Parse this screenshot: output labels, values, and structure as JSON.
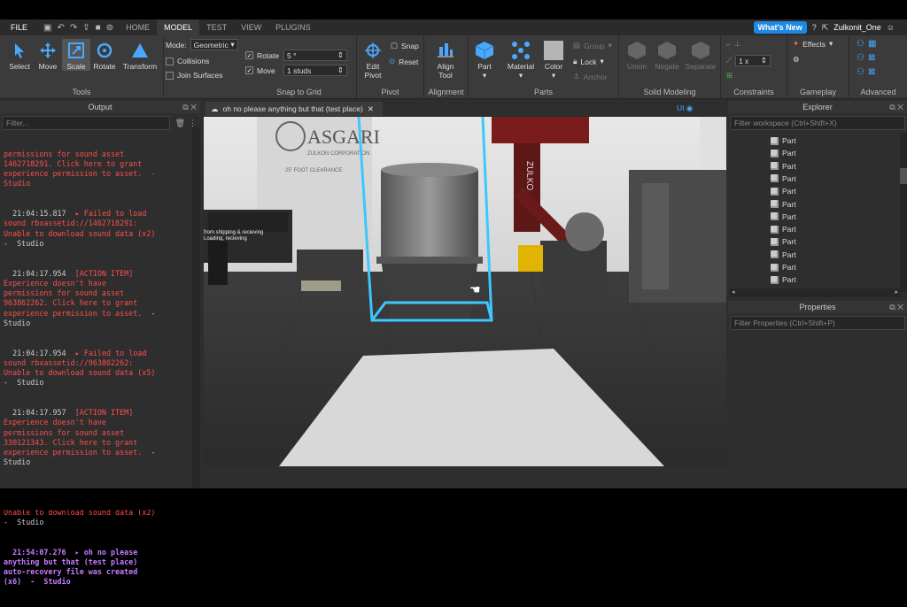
{
  "menubar": {
    "file": "FILE",
    "tabs": [
      "HOME",
      "MODEL",
      "TEST",
      "VIEW",
      "PLUGINS"
    ],
    "active_tab": "MODEL",
    "whats_new": "What's New",
    "username": "Zulkonit_One"
  },
  "ribbon": {
    "tools": {
      "select": "Select",
      "move": "Move",
      "scale": "Scale",
      "rotate": "Rotate",
      "transform": "Transform",
      "group": "Tools"
    },
    "mode_label": "Mode:",
    "mode_value": "Geometric",
    "collisions": "Collisions",
    "join_surfaces": "Join Surfaces",
    "snap": {
      "rotate_label": "Rotate",
      "rotate_value": "5 °",
      "move_label": "Move",
      "move_value": "1 studs",
      "group": "Snap to Grid"
    },
    "pivot": {
      "edit_pivot": "Edit\nPivot",
      "snap": "Snap",
      "reset": "Reset",
      "group": "Pivot"
    },
    "alignment": {
      "align_tool": "Align\nTool",
      "group": "Alignment"
    },
    "parts": {
      "part": "Part",
      "material": "Material",
      "color": "Color",
      "group_btn": "Group",
      "lock": "Lock",
      "anchor": "Anchor",
      "group": "Parts"
    },
    "solid": {
      "union": "Union",
      "negate": "Negate",
      "separate": "Separate",
      "group": "Solid Modeling"
    },
    "constraints": {
      "scale_value": "1 x",
      "group": "Constraints"
    },
    "gameplay": {
      "effects": "Effects",
      "group": "Gameplay"
    },
    "advanced": {
      "group": "Advanced"
    }
  },
  "output": {
    "title": "Output",
    "filter_placeholder": "Filter...",
    "lines": [
      {
        "t": "permissions for sound asset\n1462718291. Click here to grant\nexperience permission to asset.  -\nStudio",
        "c": "red"
      },
      {
        "t": "  21:04:15.817  ▸ Failed to load\nsound rbxassetid://1462718291:\nUnable to download sound data (x2)\n-  Studio",
        "c": "mix1"
      },
      {
        "t": "  21:04:17.954  [ACTION ITEM]\nExperience doesn't have\npermissions for sound asset\n963862262. Click here to grant\nexperience permission to asset.  -\nStudio",
        "c": "mix2"
      },
      {
        "t": "  21:04:17.954  ▸ Failed to load\nsound rbxassetid://963862262:\nUnable to download sound data (x5)\n-  Studio",
        "c": "mix1"
      },
      {
        "t": "  21:04:17.957  [ACTION ITEM]\nExperience doesn't have\npermissions for sound asset\n330121343. Click here to grant\nexperience permission to asset.  -\nStudio",
        "c": "mix2"
      },
      {
        "t": "  21:04:17.957  ▸ Failed to load\nsound rbxassetid://330121343:\nUnable to download sound data (x2)\n-  Studio",
        "c": "mix1"
      },
      {
        "t": "  21:54:07.276  ▸ oh no please\nanything but that (test place)\nauto-recovery file was created\n(x6)  -  Studio",
        "c": "purple"
      }
    ]
  },
  "viewport": {
    "tab_title": "oh no please anything but that (test place)",
    "ui_toggle": "UI",
    "sign_text": "ASGARI",
    "sign_sub": "ZULKON CORPORATION",
    "clearance": "25' FOOT CLEARANCE",
    "shipping": "from shipping & recieving\nLoading, recieving",
    "side_text": "ZULKO"
  },
  "explorer": {
    "title": "Explorer",
    "filter_placeholder": "Filter workspace (Ctrl+Shift+X)",
    "items": [
      "Part",
      "Part",
      "Part",
      "Part",
      "Part",
      "Part",
      "Part",
      "Part",
      "Part",
      "Part",
      "Part",
      "Part"
    ]
  },
  "properties": {
    "title": "Properties",
    "filter_placeholder": "Filter Properties (Ctrl+Shift+P)"
  },
  "colors": {
    "accent": "#1e88e5",
    "error": "#ff4d4d",
    "info": "#c77dff",
    "selection": "#3ec7ff"
  }
}
